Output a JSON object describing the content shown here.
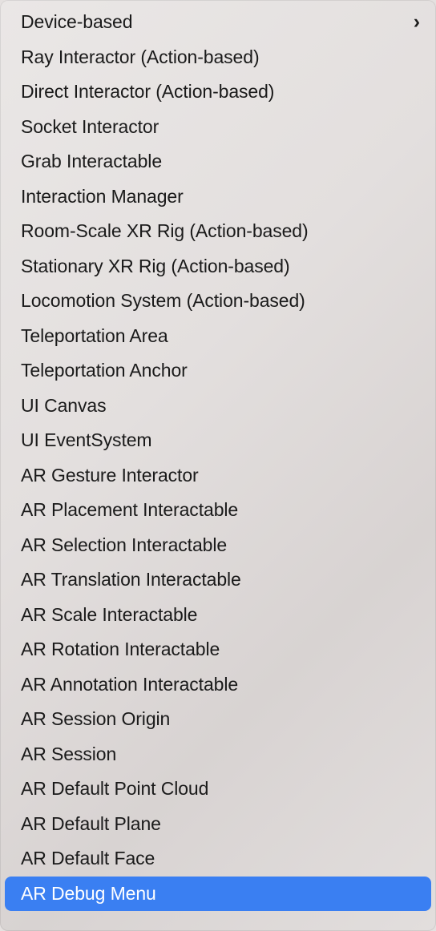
{
  "menu": {
    "items": [
      {
        "label": "Device-based",
        "has_submenu": true,
        "selected": false
      },
      {
        "label": "Ray Interactor (Action-based)",
        "has_submenu": false,
        "selected": false
      },
      {
        "label": "Direct Interactor (Action-based)",
        "has_submenu": false,
        "selected": false
      },
      {
        "label": "Socket Interactor",
        "has_submenu": false,
        "selected": false
      },
      {
        "label": "Grab Interactable",
        "has_submenu": false,
        "selected": false
      },
      {
        "label": "Interaction Manager",
        "has_submenu": false,
        "selected": false
      },
      {
        "label": "Room-Scale XR Rig (Action-based)",
        "has_submenu": false,
        "selected": false
      },
      {
        "label": "Stationary XR Rig (Action-based)",
        "has_submenu": false,
        "selected": false
      },
      {
        "label": "Locomotion System (Action-based)",
        "has_submenu": false,
        "selected": false
      },
      {
        "label": "Teleportation Area",
        "has_submenu": false,
        "selected": false
      },
      {
        "label": "Teleportation Anchor",
        "has_submenu": false,
        "selected": false
      },
      {
        "label": "UI Canvas",
        "has_submenu": false,
        "selected": false
      },
      {
        "label": "UI EventSystem",
        "has_submenu": false,
        "selected": false
      },
      {
        "label": "AR Gesture Interactor",
        "has_submenu": false,
        "selected": false
      },
      {
        "label": "AR Placement Interactable",
        "has_submenu": false,
        "selected": false
      },
      {
        "label": "AR Selection Interactable",
        "has_submenu": false,
        "selected": false
      },
      {
        "label": "AR Translation Interactable",
        "has_submenu": false,
        "selected": false
      },
      {
        "label": "AR Scale Interactable",
        "has_submenu": false,
        "selected": false
      },
      {
        "label": "AR Rotation Interactable",
        "has_submenu": false,
        "selected": false
      },
      {
        "label": "AR Annotation Interactable",
        "has_submenu": false,
        "selected": false
      },
      {
        "label": "AR Session Origin",
        "has_submenu": false,
        "selected": false
      },
      {
        "label": "AR Session",
        "has_submenu": false,
        "selected": false
      },
      {
        "label": "AR Default Point Cloud",
        "has_submenu": false,
        "selected": false
      },
      {
        "label": "AR Default Plane",
        "has_submenu": false,
        "selected": false
      },
      {
        "label": "AR Default Face",
        "has_submenu": false,
        "selected": false
      },
      {
        "label": "AR Debug Menu",
        "has_submenu": false,
        "selected": true
      }
    ]
  },
  "icons": {
    "chevron_right": "›"
  },
  "colors": {
    "selected_bg": "#3a7ff2",
    "selected_fg": "#ffffff",
    "text": "#1a1a1a"
  }
}
